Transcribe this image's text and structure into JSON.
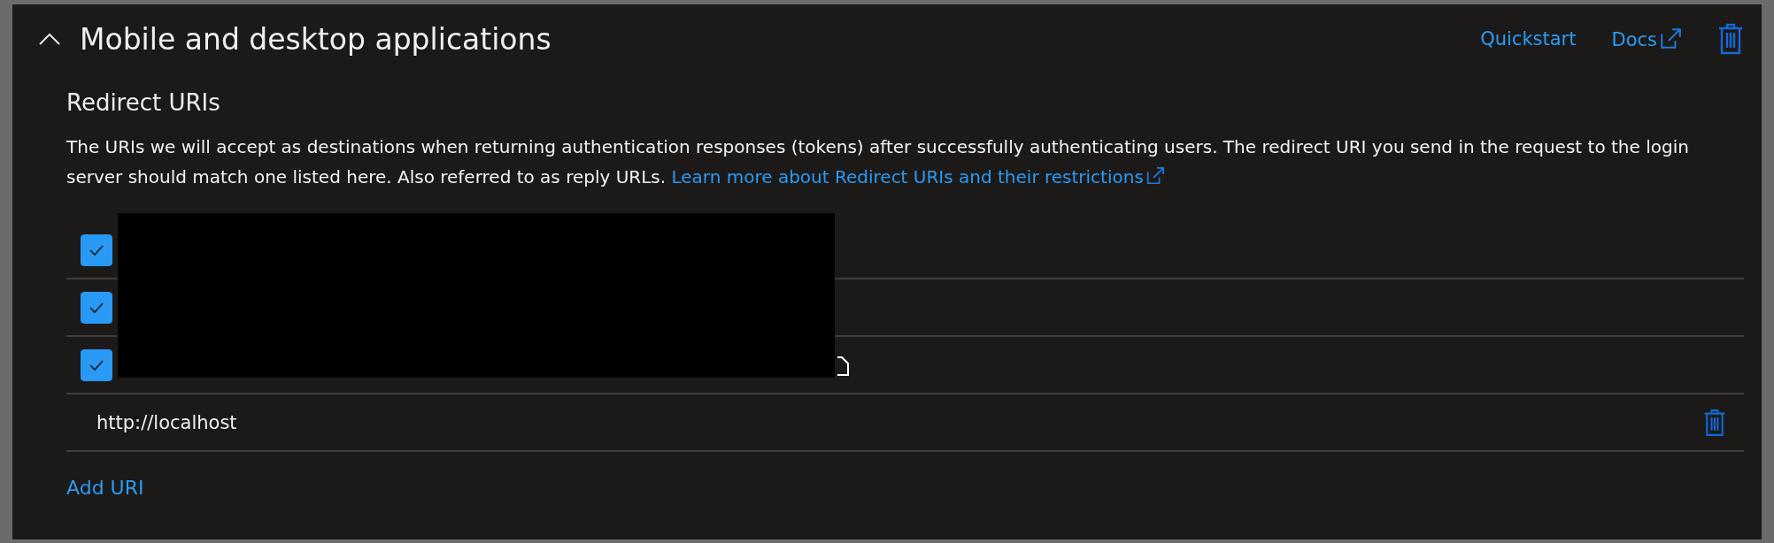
{
  "section": {
    "title": "Mobile and desktop applications",
    "expanded": true,
    "links": [
      {
        "label": "Quickstart",
        "external": false
      },
      {
        "label": "Docs",
        "external": true
      }
    ]
  },
  "redirect": {
    "heading": "Redirect URIs",
    "description": "The URIs we will accept as destinations when returning authentication responses (tokens) after successfully authenticating users. The redirect URI you send in the request to the login server should match one listed here. Also referred to as reply URLs.",
    "learn_more": "Learn more about Redirect URIs and their restrictions",
    "rows": [
      {
        "kind": "saved",
        "checked": true,
        "hovered": false
      },
      {
        "kind": "saved",
        "checked": true,
        "hovered": false
      },
      {
        "kind": "saved",
        "checked": true,
        "hovered": true
      },
      {
        "kind": "new",
        "value": "http://localhost"
      }
    ],
    "add_label": "Add URI"
  }
}
